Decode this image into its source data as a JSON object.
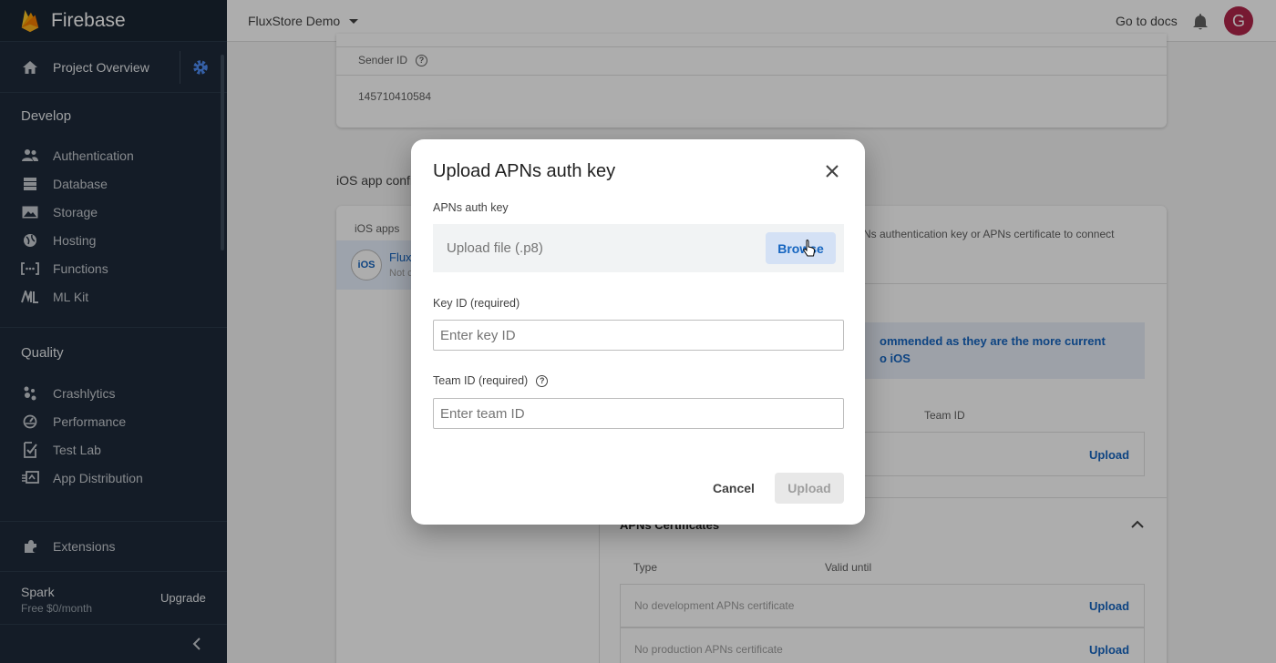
{
  "sidebar": {
    "brand": "Firebase",
    "project_overview": "Project Overview",
    "develop_title": "Develop",
    "develop_items": [
      {
        "label": "Authentication",
        "icon": "people-icon"
      },
      {
        "label": "Database",
        "icon": "database-icon"
      },
      {
        "label": "Storage",
        "icon": "image-icon"
      },
      {
        "label": "Hosting",
        "icon": "globe-icon"
      },
      {
        "label": "Functions",
        "icon": "functions-icon"
      },
      {
        "label": "ML Kit",
        "icon": "mlkit-icon"
      }
    ],
    "quality_title": "Quality",
    "quality_items": [
      {
        "label": "Crashlytics",
        "icon": "crashlytics-icon"
      },
      {
        "label": "Performance",
        "icon": "performance-icon"
      },
      {
        "label": "Test Lab",
        "icon": "checklist-icon"
      },
      {
        "label": "App Distribution",
        "icon": "distribution-icon"
      }
    ],
    "extensions": "Extensions",
    "plan_name": "Spark",
    "plan_sub": "Free $0/month",
    "upgrade": "Upgrade"
  },
  "topbar": {
    "project": "FluxStore Demo",
    "go_to_docs": "Go to docs",
    "avatar_letter": "G"
  },
  "background": {
    "sender_id_label": "Sender ID",
    "sender_id_value": "145710410584",
    "ios_config_title": "iOS app confi",
    "ios_apps_label": "iOS apps",
    "ios_badge": "iOS",
    "ios_app_name": "Flux",
    "ios_app_sub": "Not c",
    "right_text": "Ns authentication key or APNs certificate to connect",
    "info_line1": "ommended as they are the more current",
    "info_line2": "o iOS",
    "team_id_header": "Team ID",
    "upload_link": "Upload",
    "apns_certificates": "APNs Certificates",
    "type_header": "Type",
    "valid_until_header": "Valid until",
    "no_dev_cert": "No development APNs certificate",
    "no_prod_cert": "No production APNs certificate"
  },
  "dialog": {
    "title": "Upload APNs auth key",
    "auth_key_label": "APNs auth key",
    "upload_placeholder": "Upload file (.p8)",
    "browse": "Browse",
    "key_id_label": "Key ID (required)",
    "key_id_placeholder": "Enter key ID",
    "team_id_label": "Team ID (required)",
    "team_id_placeholder": "Enter team ID",
    "cancel": "Cancel",
    "upload": "Upload"
  },
  "colors": {
    "sidebar_bg": "#1e2a3a",
    "accent_blue": "#1565c0",
    "avatar_bg": "#b0254a",
    "firebase_yellow": "#ffca28",
    "firebase_orange": "#f57c00"
  }
}
